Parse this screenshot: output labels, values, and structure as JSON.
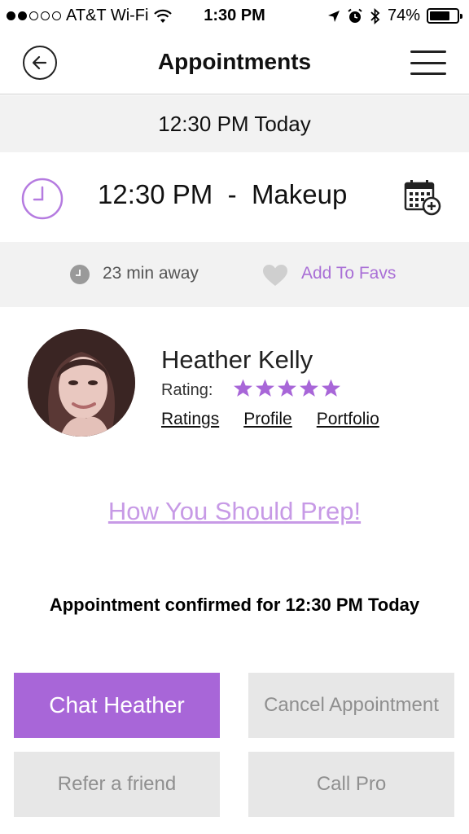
{
  "status_bar": {
    "carrier": "AT&T Wi-Fi",
    "time": "1:30 PM",
    "battery": "74%",
    "battery_level": 0.74,
    "signal_bars": 2,
    "signal_total": 5
  },
  "header": {
    "title": "Appointments",
    "back_icon": "back-arrow-circle-icon",
    "menu_icon": "hamburger-menu-icon"
  },
  "date_bar": {
    "text": "12:30 PM Today"
  },
  "appointment": {
    "time": "12:30 PM",
    "separator": "-",
    "service": "Makeup",
    "clock_icon": "clock-icon",
    "calendar_icon": "calendar-add-icon"
  },
  "info_bar": {
    "distance": "23 min away",
    "favorite": "Add To Favs"
  },
  "provider": {
    "name": "Heather Kelly",
    "rating_label": "Rating:",
    "rating": 5,
    "rating_max": 5,
    "links": [
      "Ratings",
      "Profile",
      "Portfolio"
    ]
  },
  "prep_link": "How You Should Prep!",
  "confirmation": "Appointment confirmed for 12:30 PM Today",
  "buttons": {
    "chat": "Chat Heather",
    "cancel": "Cancel Appointment",
    "refer": "Refer a friend",
    "call": "Call Pro"
  },
  "colors": {
    "accent": "#a866d8",
    "accent_light": "#c79ae6",
    "panel": "#f2f2f2",
    "button_secondary": "#e7e7e7"
  }
}
